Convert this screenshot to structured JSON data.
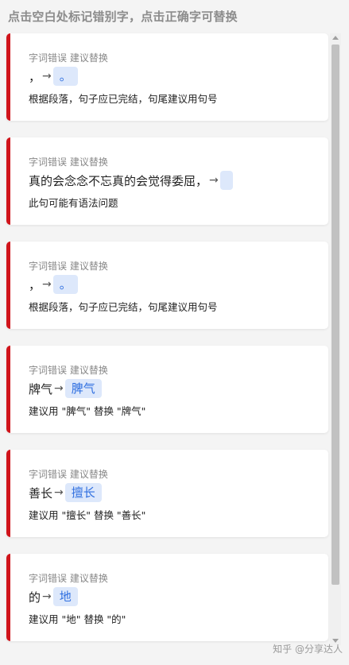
{
  "header": {
    "title": "点击空白处标记错别字，点击正确字可替换"
  },
  "cards": [
    {
      "type_label": "字词错误 建议替换",
      "original": "，",
      "arrow": "→",
      "replacement": "。",
      "description": "根据段落，句子应已完结，句尾建议用句号"
    },
    {
      "type_label": "字词错误 建议替换",
      "original": "真的会念念不忘真的会觉得委屈，",
      "arrow": "→",
      "replacement": "",
      "description": "此句可能有语法问题"
    },
    {
      "type_label": "字词错误 建议替换",
      "original": "，",
      "arrow": "→",
      "replacement": "。",
      "description": "根据段落，句子应已完结，句尾建议用句号"
    },
    {
      "type_label": "字词错误 建议替换",
      "original": "牌气",
      "arrow": "→",
      "replacement": "脾气",
      "description": "建议用 \"脾气\" 替换 \"牌气\""
    },
    {
      "type_label": "字词错误 建议替换",
      "original": "善长",
      "arrow": "→",
      "replacement": "擅长",
      "description": "建议用 \"擅长\" 替换 \"善长\""
    },
    {
      "type_label": "字词错误 建议替换",
      "original": "的",
      "arrow": "→",
      "replacement": "地",
      "description": "建议用 \"地\" 替换 \"的\""
    }
  ],
  "watermark": "知乎 @分享达人",
  "colors": {
    "error_bar": "#d0141b",
    "replacement_bg": "#dde8fb",
    "replacement_text": "#2f6fe0"
  }
}
